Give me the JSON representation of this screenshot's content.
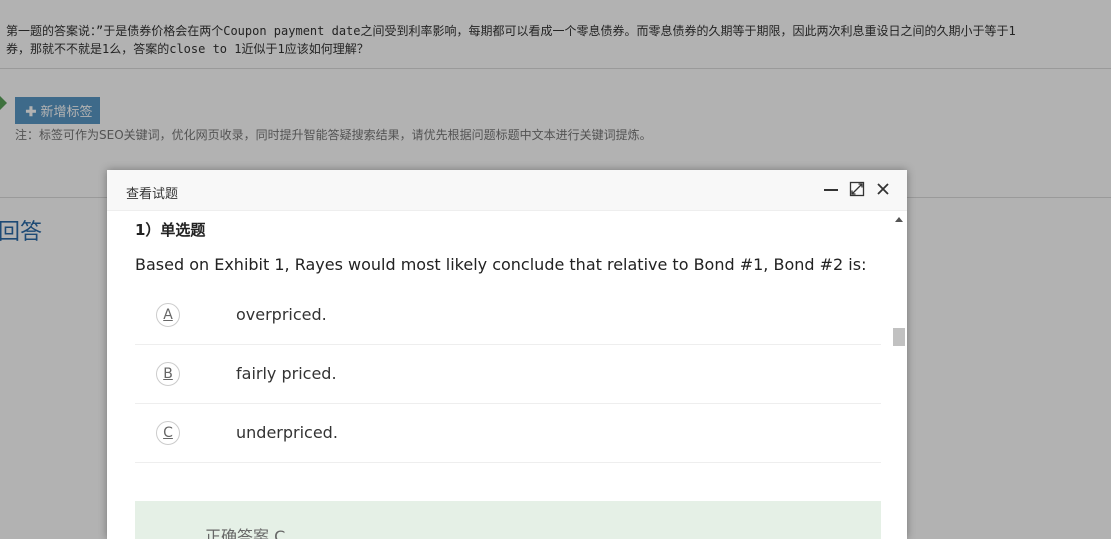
{
  "background": {
    "question_line1": "第一题的答案说：”于是债券价格会在两个Coupon payment date之间受到利率影响，每期都可以看成一个零息债券。而零息债券的久期等于期限，因此两次利息重设日之间的久期小于等于1",
    "question_line2": "券，那就不不就是1么，答案的close to 1近似于1应该如何理解？",
    "add_tag_label": "新增标签",
    "tag_note": "注：标签可作为SEO关键词，优化网页收录，同时提升智能答疑搜索结果，请优先根据问题标题中文本进行关键词提炼。",
    "answer_heading": "回答"
  },
  "modal": {
    "title": "查看试题",
    "question_number": "1）单选题",
    "stem": "Based on Exhibit 1, Rayes would most likely conclude that relative to Bond #1, Bond #2 is:",
    "options": [
      {
        "letter": "A",
        "text": "overpriced."
      },
      {
        "letter": "B",
        "text": "fairly priced."
      },
      {
        "letter": "C",
        "text": "underpriced."
      }
    ],
    "correct_answer": "正确答案 C"
  },
  "colors": {
    "tag_button": "#5a99c6",
    "answer_heading": "#2a6aa8",
    "answer_box": "#e5f0e6"
  },
  "icons": [
    "plus-icon",
    "tag-arrow-icon",
    "minimize-icon",
    "maximize-icon",
    "close-icon",
    "scroll-up-arrow-icon"
  ]
}
